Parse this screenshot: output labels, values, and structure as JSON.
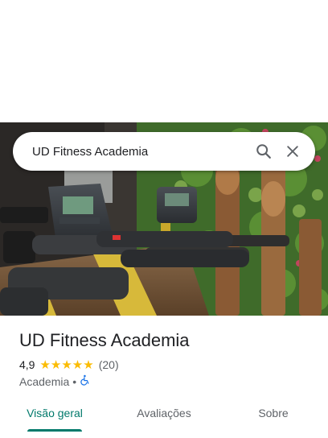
{
  "search": {
    "query": "UD Fitness Academia"
  },
  "place": {
    "name": "UD Fitness Academia",
    "rating": "4,9",
    "stars": "★★★★★",
    "review_count": "(20)",
    "category": "Academia",
    "separator": "•",
    "accessibility_icon": "wheelchair-icon"
  },
  "tabs": [
    {
      "label": "Visão geral",
      "active": true
    },
    {
      "label": "Avaliações",
      "active": false
    },
    {
      "label": "Sobre",
      "active": false
    }
  ],
  "colors": {
    "accent": "#00796b",
    "star": "#fbbc04",
    "accessibility": "#1a73e8"
  }
}
